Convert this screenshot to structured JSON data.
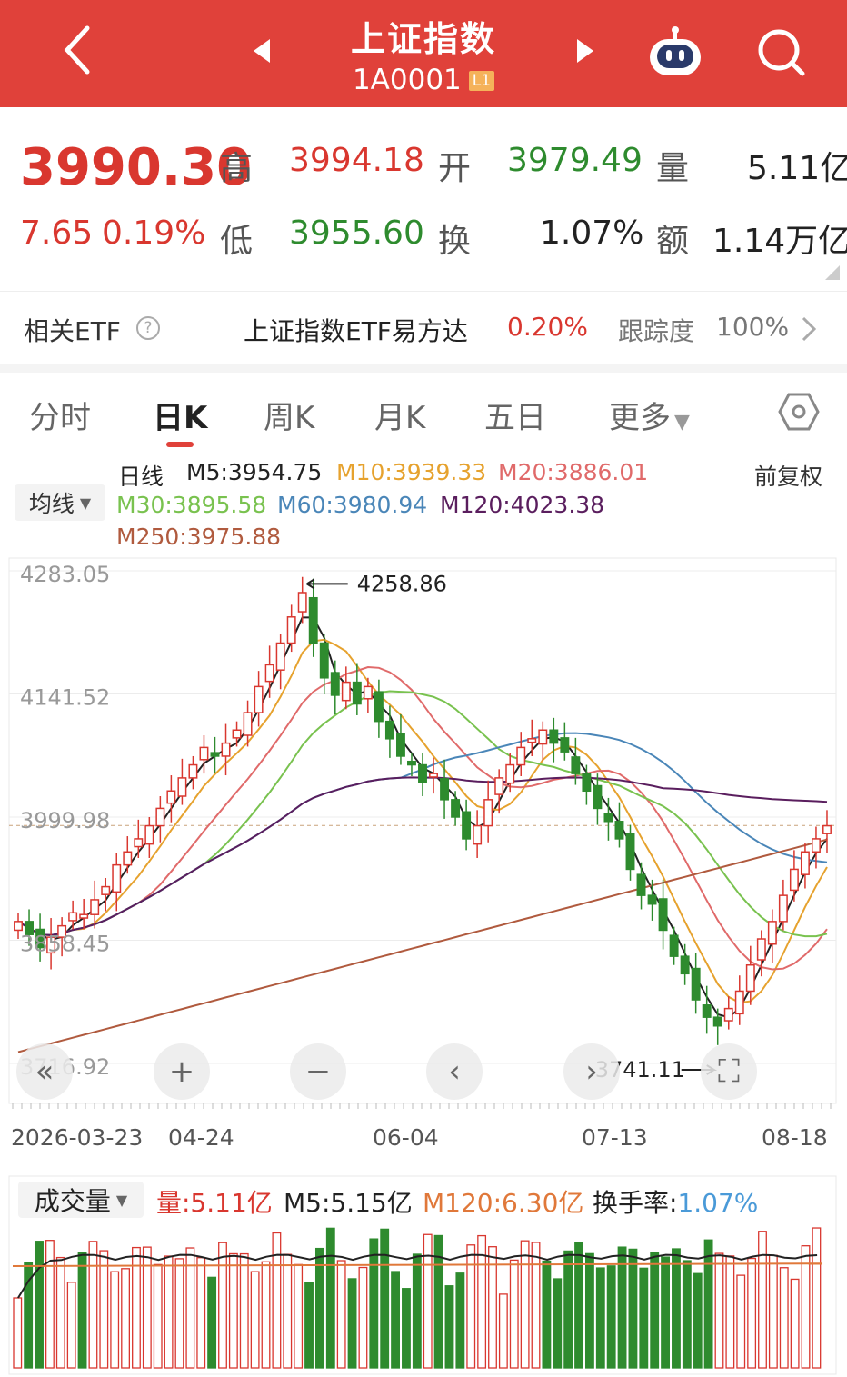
{
  "header": {
    "title": "上证指数",
    "code": "1A0001",
    "level_badge": "L1",
    "icons": [
      "back-icon",
      "prev-triangle-icon",
      "next-triangle-icon",
      "robot-assistant-icon",
      "search-icon"
    ]
  },
  "quote": {
    "price": "3990.30",
    "change": "7.65",
    "change_pct": "0.19%",
    "high_label": "高",
    "high": "3994.18",
    "open_label": "开",
    "open": "3979.49",
    "volume_label": "量",
    "volume": "5.11亿",
    "low_label": "低",
    "low": "3955.60",
    "turnover_label": "换",
    "turnover": "1.07%",
    "amount_label": "额",
    "amount": "1.14万亿"
  },
  "etf": {
    "label": "相关ETF",
    "name": "上证指数ETF易方达",
    "pct": "0.20%",
    "track_label": "跟踪度",
    "track": "100%"
  },
  "tabs": [
    {
      "label": "分时"
    },
    {
      "label": "日K"
    },
    {
      "label": "周K"
    },
    {
      "label": "月K"
    },
    {
      "label": "五日"
    },
    {
      "label": "更多"
    }
  ],
  "ma_select": "均线",
  "adjust": "前复权",
  "ma": {
    "period": "日线",
    "m5": "M5:3954.75",
    "m10": "M10:3939.33",
    "m20": "M20:3886.01",
    "m30": "M30:3895.58",
    "m60": "M60:3980.94",
    "m120": "M120:4023.38",
    "m250": "M250:3975.88"
  },
  "colors": {
    "up": "#d9372f",
    "down": "#2e8b2e",
    "m5": "#222222",
    "m10": "#e6a22e",
    "m20": "#e06a6a",
    "m30": "#79c24f",
    "m60": "#4a86b8",
    "m120": "#5a1e5e",
    "m250": "#b05a3e"
  },
  "chart_data": {
    "type": "candlestick",
    "y_ticks": [
      "4283.05",
      "4141.52",
      "3999.98",
      "3858.45",
      "3716.92"
    ],
    "x_ticks": [
      "2026-03-23",
      "04-24",
      "06-04",
      "07-13",
      "08-18"
    ],
    "annotations": {
      "high": "4258.86",
      "low": "3741.11"
    },
    "closes": [
      3880,
      3865,
      3850,
      3862,
      3875,
      3890,
      3888,
      3905,
      3920,
      3945,
      3960,
      3975,
      3990,
      4010,
      4030,
      4045,
      4060,
      4080,
      4070,
      4085,
      4100,
      4120,
      4150,
      4175,
      4200,
      4230,
      4258,
      4200,
      4160,
      4140,
      4155,
      4130,
      4150,
      4110,
      4090,
      4070,
      4060,
      4040,
      4050,
      4020,
      4000,
      3975,
      3990,
      4020,
      4045,
      4060,
      4080,
      4090,
      4100,
      4085,
      4075,
      4050,
      4030,
      4010,
      3995,
      3975,
      3940,
      3910,
      3900,
      3870,
      3840,
      3820,
      3790,
      3770,
      3760,
      3780,
      3800,
      3830,
      3860,
      3880,
      3910,
      3940,
      3960,
      3975,
      3990
    ]
  },
  "volume": {
    "label": "成交量",
    "vol": "量:5.11亿",
    "m5": "M5:5.15亿",
    "m120": "M120:6.30亿",
    "turnover_label": "换手率:",
    "turnover": "1.07%"
  }
}
